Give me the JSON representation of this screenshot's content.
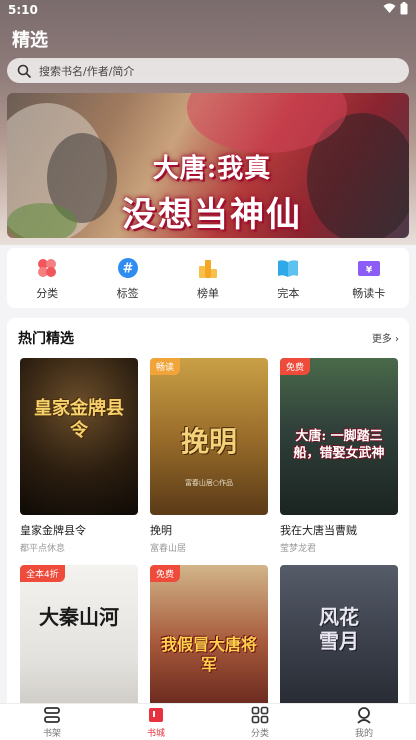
{
  "status_bar": {
    "time": "5:10"
  },
  "header": {
    "title": "精选"
  },
  "search": {
    "placeholder": "搜索书名/作者/简介"
  },
  "banner": {
    "line1": "大唐:我真",
    "line2": "没想当神仙"
  },
  "quick_nav": [
    {
      "label": "分类",
      "icon": "clover-icon",
      "color": "#f0575d"
    },
    {
      "label": "标签",
      "icon": "hash-icon",
      "color": "#2f8cf0"
    },
    {
      "label": "榜单",
      "icon": "chart-icon",
      "color": "#f5a623"
    },
    {
      "label": "完本",
      "icon": "book-open-icon",
      "color": "#2fa8e8"
    },
    {
      "label": "畅读卡",
      "icon": "card-icon",
      "color": "#8b5cf6"
    }
  ],
  "hot": {
    "title": "热门精选",
    "more": "更多",
    "books": [
      {
        "title": "皇家金牌县令",
        "author": "都平点休息",
        "badge": "",
        "cover_text": "皇家金牌县令",
        "cover_sub": ""
      },
      {
        "title": "挽明",
        "author": "富春山居",
        "badge": "畅读",
        "cover_text": "挽明",
        "cover_sub": "富春山居○作品"
      },
      {
        "title": "我在大唐当曹贼",
        "author": "莹梦龙君",
        "badge": "免费",
        "cover_text": "大唐: 一脚踏三船，错娶女武神",
        "cover_sub": ""
      },
      {
        "title": "",
        "author": "",
        "badge": "全本4折",
        "cover_text": "大秦山河",
        "cover_sub": ""
      },
      {
        "title": "",
        "author": "",
        "badge": "免费",
        "cover_text": "我假冒大唐将军",
        "cover_sub": ""
      },
      {
        "title": "",
        "author": "",
        "badge": "",
        "cover_text": "风花雪月",
        "cover_sub": ""
      }
    ]
  },
  "tabs": [
    {
      "label": "书架",
      "icon": "bookshelf-icon",
      "active": false
    },
    {
      "label": "书城",
      "icon": "bookstore-icon",
      "active": true
    },
    {
      "label": "分类",
      "icon": "grid-icon",
      "active": false
    },
    {
      "label": "我的",
      "icon": "profile-icon",
      "active": false
    }
  ],
  "colors": {
    "accent": "#e8313c",
    "badge_free": "#ee4b3b",
    "badge_read": "#f1a43a",
    "badge_full": "#ee4b3b"
  }
}
